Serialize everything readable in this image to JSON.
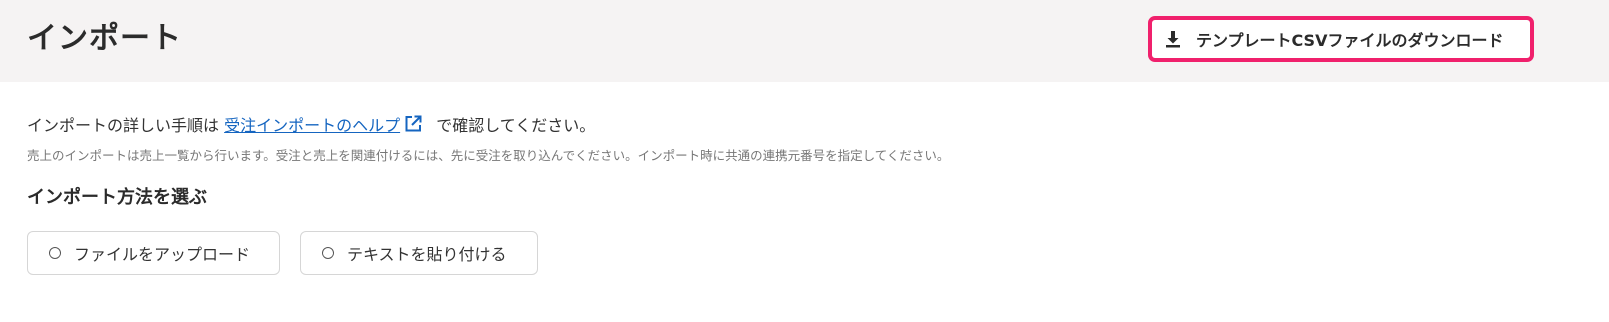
{
  "header": {
    "title": "インポート",
    "download_button": {
      "label": "テンプレートCSVファイルのダウンロード",
      "icon": "download-icon",
      "highlight_color": "#f0206c"
    }
  },
  "main": {
    "help": {
      "prefix": "インポートの詳しい手順は ",
      "link_text": "受注インポートのヘルプ",
      "link_icon": "external-link-icon",
      "suffix": " で確認してください。",
      "link_color": "#1565c0"
    },
    "note": "売上のインポートは売上一覧から行います。受注と売上を関連付けるには、先に受注を取り込んでください。インポート時に共通の連携元番号を指定してください。",
    "method_section": {
      "title": "インポート方法を選ぶ",
      "options": [
        {
          "label": "ファイルをアップロード",
          "selected": false
        },
        {
          "label": "テキストを貼り付ける",
          "selected": false
        }
      ]
    }
  }
}
